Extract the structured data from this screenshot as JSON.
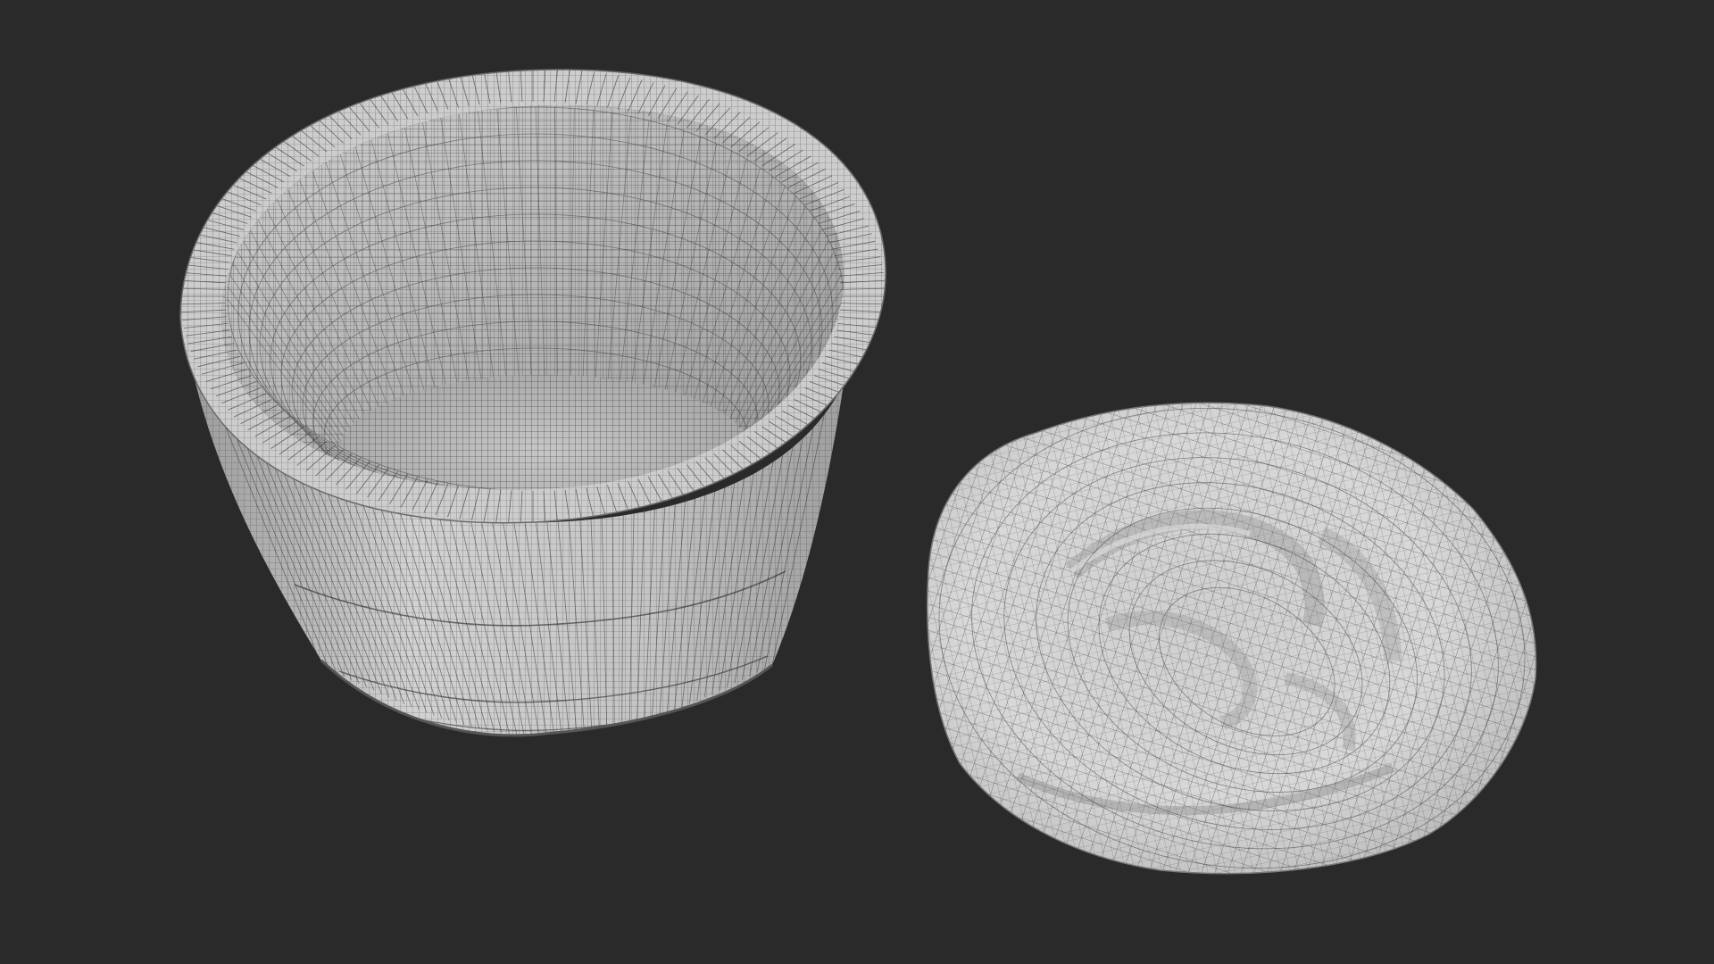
{
  "scene": {
    "background_color": "#2a2a2a",
    "mesh_fill_light": "#d9d9d9",
    "mesh_fill_mid": "#b8b8b8",
    "mesh_fill_dark": "#8e8e8e",
    "wire_color": "#3a3a3a",
    "objects": [
      {
        "name": "ramekin-bowl",
        "render_style": "wireframe-on-shaded"
      },
      {
        "name": "crumpled-lid",
        "render_style": "wireframe-on-shaded"
      }
    ]
  }
}
